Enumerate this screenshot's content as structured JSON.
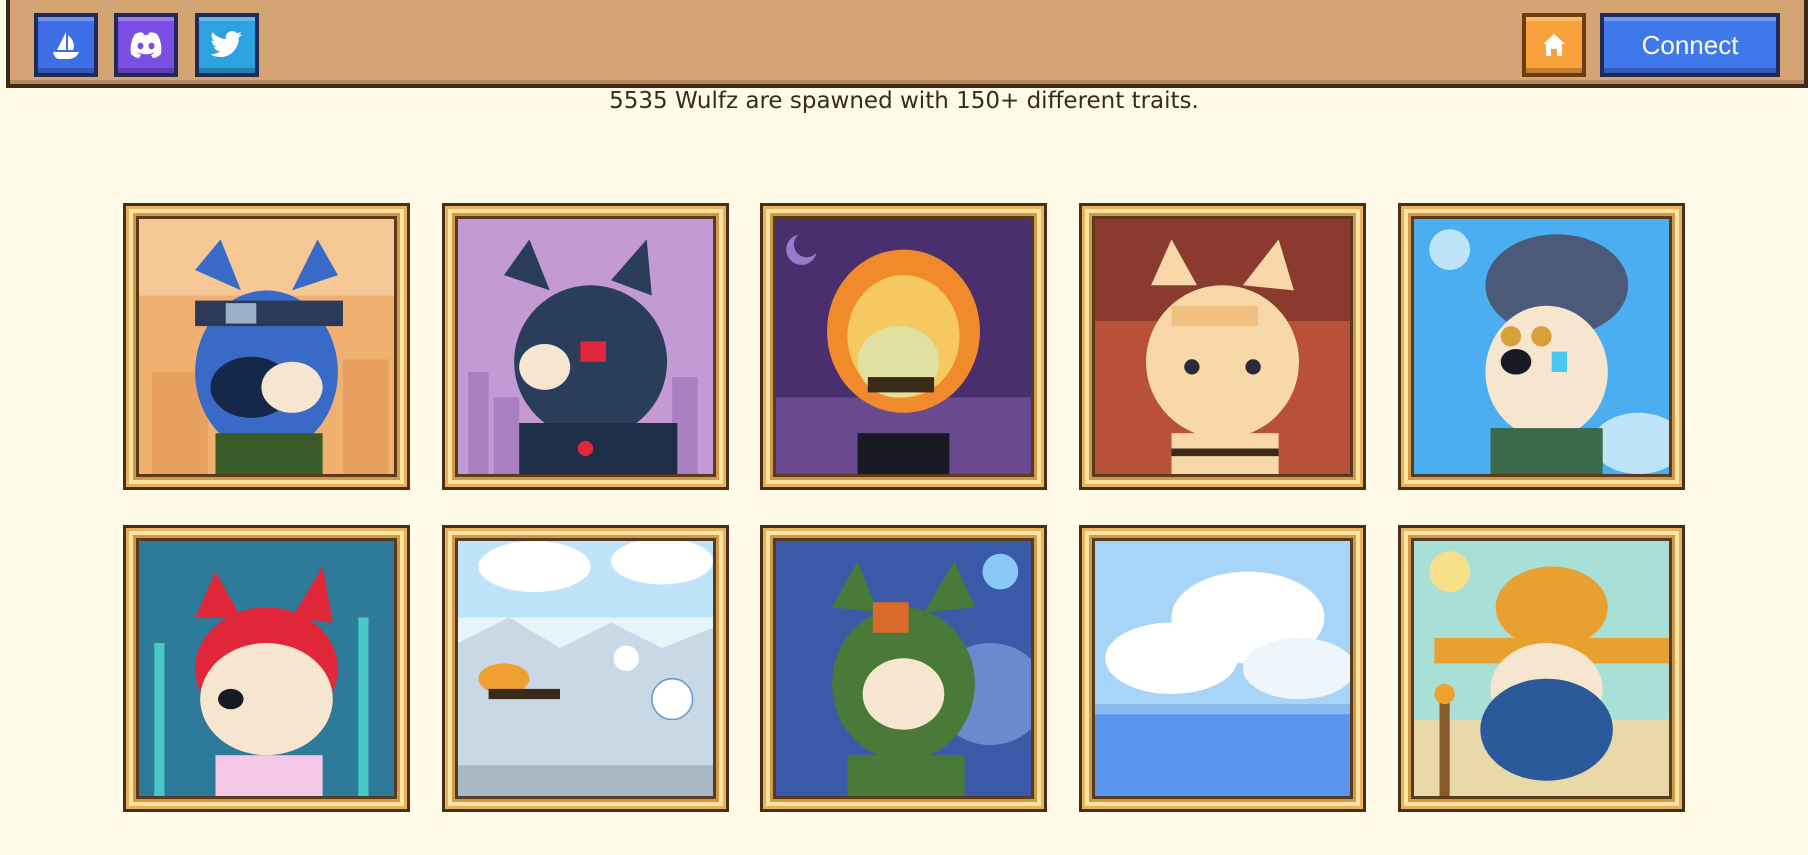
{
  "nav": {
    "left_buttons": [
      {
        "icon": "opensea-icon",
        "color": "#3f6fe6"
      },
      {
        "icon": "discord-icon",
        "color": "#7b4fe6"
      },
      {
        "icon": "twitter-icon",
        "color": "#2ea2e0"
      }
    ],
    "home_icon": "home-icon",
    "connect_label": "Connect"
  },
  "subtitle": "5535 Wulfz are spawned with 150+ different traits.",
  "gallery": {
    "rows": 2,
    "columns": 5,
    "items": [
      {
        "theme": "ninja-headband-wolf",
        "bg": "#f0b070"
      },
      {
        "theme": "cyborg-wolf",
        "bg": "#c49ad4"
      },
      {
        "theme": "flaming-skull-wolf",
        "bg": "#4a2f6e"
      },
      {
        "theme": "fire-ninja-wolf",
        "bg": "#b8503a"
      },
      {
        "theme": "beanie-goggles-wolf",
        "bg": "#4aaef0"
      },
      {
        "theme": "red-haired-wolf",
        "bg": "#2e7a9a"
      },
      {
        "theme": "snow-sledding-scene",
        "bg": "#e6f4fa"
      },
      {
        "theme": "green-helmet-wolf",
        "bg": "#3a5aa8"
      },
      {
        "theme": "sky-clouds-scene",
        "bg": "#a8d4f8"
      },
      {
        "theme": "straw-hat-wolf",
        "bg": "#a8e0d8"
      }
    ]
  }
}
